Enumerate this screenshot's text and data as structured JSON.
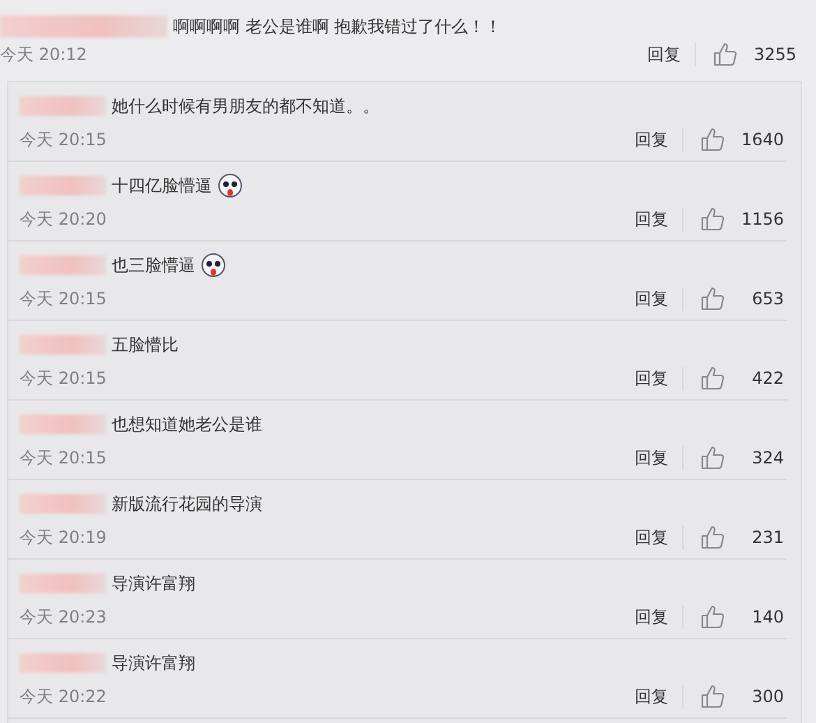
{
  "comment": {
    "text": "啊啊啊啊 老公是谁啊 抱歉我错过了什么！！",
    "time": "今天 20:12",
    "reply": "回复",
    "likes": "3255"
  },
  "replies": [
    {
      "text": "她什么时候有男朋友的都不知道。。",
      "emoji": false,
      "time": "今天 20:15",
      "reply": "回复",
      "likes": "1640"
    },
    {
      "text": "十四亿脸懵逼",
      "emoji": true,
      "time": "今天 20:20",
      "reply": "回复",
      "likes": "1156"
    },
    {
      "text": "也三脸懵逼",
      "emoji": true,
      "time": "今天 20:15",
      "reply": "回复",
      "likes": "653"
    },
    {
      "text": "五脸懵比",
      "emoji": false,
      "time": "今天 20:15",
      "reply": "回复",
      "likes": "422"
    },
    {
      "text": "也想知道她老公是谁",
      "emoji": false,
      "time": "今天 20:15",
      "reply": "回复",
      "likes": "324"
    },
    {
      "text": "新版流行花园的导演",
      "emoji": false,
      "time": "今天 20:19",
      "reply": "回复",
      "likes": "231"
    },
    {
      "text": "导演许富翔",
      "emoji": false,
      "time": "今天 20:23",
      "reply": "回复",
      "likes": "140"
    },
    {
      "text": "导演许富翔",
      "emoji": false,
      "time": "今天 20:22",
      "reply": "回复",
      "likes": "300"
    }
  ]
}
